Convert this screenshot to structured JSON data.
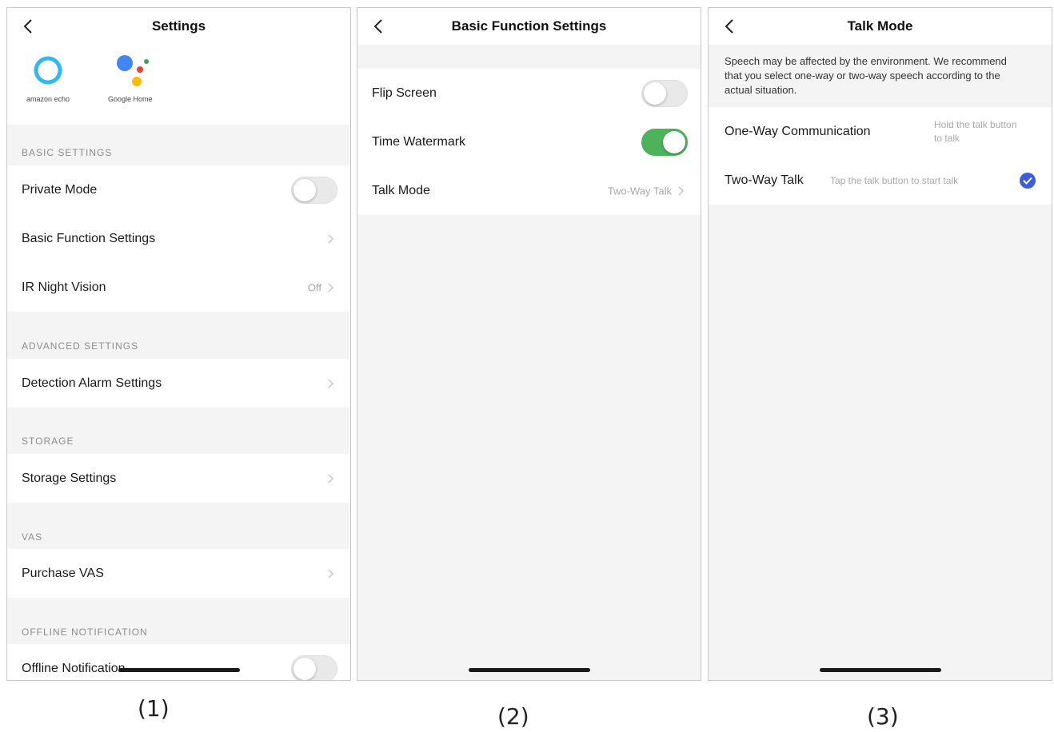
{
  "screen1": {
    "title": "Settings",
    "logos": {
      "alexa_caption": "amazon echo",
      "google_caption": "Google Home"
    },
    "sections": {
      "basic": "BASIC SETTINGS",
      "advanced": "ADVANCED SETTINGS",
      "storage": "STORAGE",
      "vas": "VAS",
      "offline": "OFFLINE NOTIFICATION"
    },
    "rows": {
      "private_mode": "Private Mode",
      "basic_function": "Basic Function Settings",
      "ir_night_vision": "IR Night Vision",
      "ir_night_vision_value": "Off",
      "detection_alarm": "Detection Alarm Settings",
      "storage_settings": "Storage Settings",
      "purchase_vas": "Purchase VAS",
      "offline_notification": "Offline Notification"
    },
    "toggles": {
      "private_mode": false,
      "offline_notification": false
    }
  },
  "screen2": {
    "title": "Basic Function Settings",
    "rows": {
      "flip_screen": "Flip Screen",
      "time_watermark": "Time Watermark",
      "talk_mode": "Talk Mode",
      "talk_mode_value": "Two-Way Talk"
    },
    "toggles": {
      "flip_screen": false,
      "time_watermark": true
    }
  },
  "screen3": {
    "title": "Talk Mode",
    "notice": "Speech may be affected by the environment. We recommend that you select one-way or two-way speech according to the actual situation.",
    "options": {
      "one_way_label": "One-Way Communication",
      "one_way_hint": "Hold the talk button to talk",
      "two_way_label": "Two-Way Talk",
      "two_way_hint": "Tap the talk button to start talk"
    },
    "selected": "two_way"
  },
  "captions": {
    "c1": "(1)",
    "c2": "(2)",
    "c3": "(3)"
  },
  "colors": {
    "toggle_on": "#4cb35a",
    "check": "#3d5fd6",
    "alexa_blue": "#2fb8f2",
    "google_blue": "#4285f4",
    "google_red": "#ea4335",
    "google_yellow": "#fbbc05",
    "google_green": "#34a853"
  },
  "icons": [
    "back-chevron-icon",
    "chevron-right-icon",
    "alexa-logo-icon",
    "google-assistant-logo-icon",
    "checkmark-icon"
  ]
}
